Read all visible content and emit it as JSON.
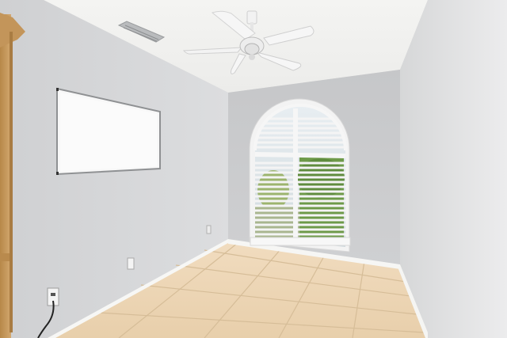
{
  "scene": {
    "description_visible_text": "",
    "colors": {
      "ceiling": "#f3f3f1",
      "left_wall": "#d4d5d6",
      "back_wall": "#c9cacc",
      "right_wall": "#e3e4e5",
      "floor_tile": "#ecd4b3",
      "grout": "#d2b995",
      "baseboard": "#f6f6f4",
      "window_frame": "#f7f7f7",
      "foliage": "#6f9a4c",
      "cabinet_wood": "#c79b61"
    },
    "objects": [
      "ceiling-fan",
      "air-vent",
      "whiteboard",
      "arched-window",
      "plantation-shutters",
      "tile-floor",
      "baseboard",
      "electrical-outlet",
      "wall-outlet-with-cord",
      "wood-cabinet-edge"
    ]
  }
}
